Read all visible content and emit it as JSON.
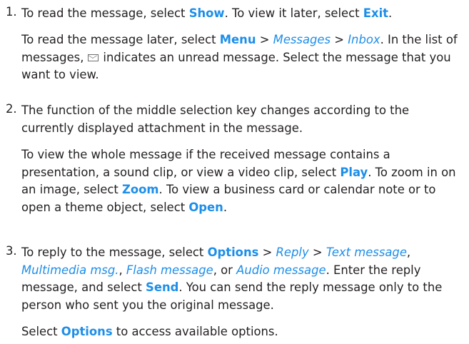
{
  "colors": {
    "accent": "#1d8ee8",
    "text": "#231f20"
  },
  "steps": [
    {
      "number": "1.",
      "para1": {
        "t1": "To read the message, select ",
        "show": "Show",
        "t2": ". To view it later, select ",
        "exit": "Exit",
        "t3": "."
      },
      "para2": {
        "t1": "To read the message later, select ",
        "menu": "Menu",
        "sep1": " > ",
        "messages": "Messages",
        "sep2": " > ",
        "inbox": "Inbox",
        "t2": ". In the list of messages,",
        "icon": "unread-envelope-icon",
        "t3": "indicates an unread message. Select the message that you want to view."
      }
    },
    {
      "number": "2.",
      "para1": {
        "t1": "The function of the middle selection key changes according to the currently displayed attachment in the message."
      },
      "para2": {
        "t1": "To view the whole message if the received message contains a presentation, a sound clip, or view a video clip, select ",
        "play": "Play",
        "t2": ". To zoom in on an image, select ",
        "zoom": "Zoom",
        "t3": ". To view a business card or calendar note or to open a theme object, select ",
        "open": "Open",
        "t4": "."
      }
    },
    {
      "number": "3.",
      "para1": {
        "t1": "To reply to the message, select ",
        "options": "Options",
        "sep1": " > ",
        "reply": "Reply",
        "sep2": " > ",
        "text_message": "Text message",
        "c1": ", ",
        "multimedia": "Multimedia msg.",
        "c2": ", ",
        "flash": "Flash message",
        "c3": ", or ",
        "audio": "Audio message",
        "t2": ". Enter the reply message, and select ",
        "send": "Send",
        "t3": ". You can send the reply message only to the person who sent you the original message."
      },
      "para2": {
        "t1": "Select ",
        "options": "Options",
        "t2": " to access available options."
      }
    }
  ]
}
